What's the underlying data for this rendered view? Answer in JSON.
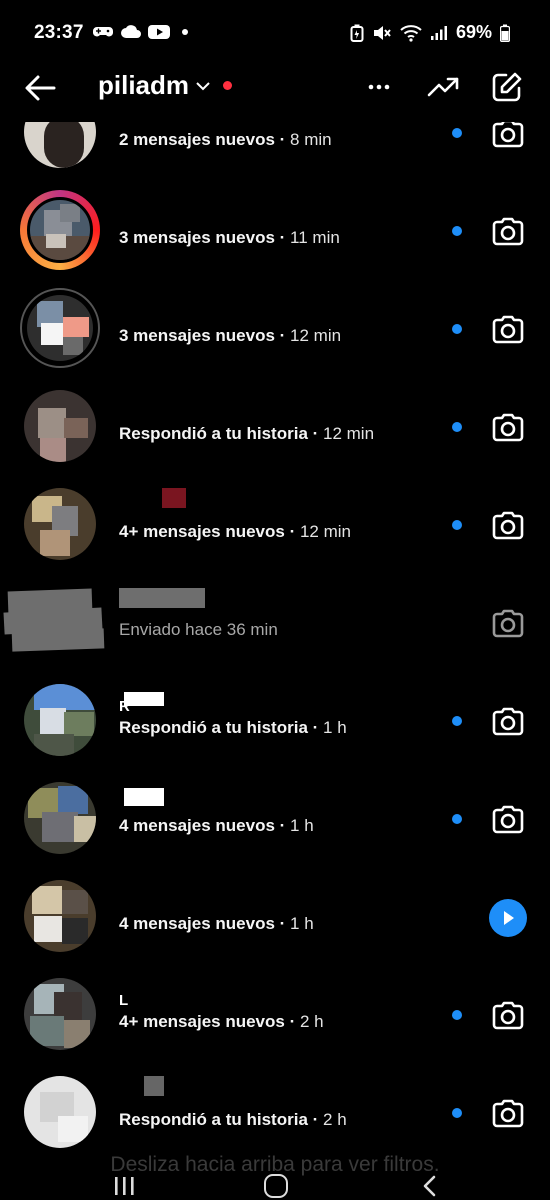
{
  "status_bar": {
    "time": "23:37",
    "battery": "69%"
  },
  "header": {
    "username": "piliadm",
    "icons": [
      "back-arrow-icon",
      "chevron-down-icon",
      "more-icon",
      "trending-icon",
      "new-message-icon"
    ],
    "online_dot_color": "#ff3040"
  },
  "conversations": [
    {
      "name": "",
      "message": "2 mensajes nuevos",
      "time": "8 min",
      "unread": true,
      "action": "camera"
    },
    {
      "name": "",
      "message": "3 mensajes nuevos",
      "time": "11 min",
      "unread": true,
      "action": "camera",
      "story_ring": true
    },
    {
      "name": "",
      "message": "3 mensajes nuevos",
      "time": "12 min",
      "unread": true,
      "action": "camera"
    },
    {
      "name": "",
      "message": "Respondió a tu historia",
      "time": "12 min",
      "unread": true,
      "action": "camera"
    },
    {
      "name": "",
      "message": "4+ mensajes nuevos",
      "time": "12 min",
      "unread": true,
      "action": "camera"
    },
    {
      "name": "",
      "message": "Enviado hace 36 min",
      "time": "",
      "unread": false,
      "action": "camera"
    },
    {
      "name": "R",
      "message": "Respondió a tu historia",
      "time": "1 h",
      "unread": true,
      "action": "camera"
    },
    {
      "name": "",
      "message": "4 mensajes nuevos",
      "time": "1 h",
      "unread": true,
      "action": "camera"
    },
    {
      "name": "",
      "message": "4 mensajes nuevos",
      "time": "1 h",
      "unread": false,
      "action": "play"
    },
    {
      "name": "L",
      "message": "4+ mensajes nuevos",
      "time": "2 h",
      "unread": true,
      "action": "camera"
    },
    {
      "name": "",
      "message": "Respondió a tu historia",
      "time": "2 h",
      "unread": true,
      "action": "camera"
    }
  ],
  "hint": "Desliza hacia arriba para ver filtros.",
  "colors": {
    "accent": "#1e8ef8",
    "background": "#000000"
  }
}
